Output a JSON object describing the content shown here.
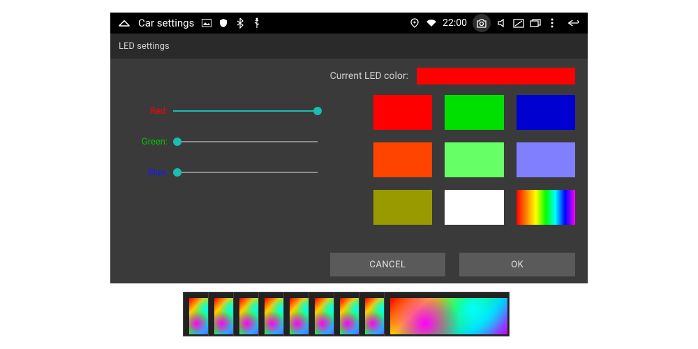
{
  "status": {
    "title": "Car settings",
    "clock": "22:00"
  },
  "page": {
    "header": "LED settings",
    "current_label": "Current LED color:",
    "current_color": "#ff0000"
  },
  "sliders": {
    "red": {
      "label": "Red:",
      "value": 100
    },
    "green": {
      "label": "Green:",
      "value": 3
    },
    "blue": {
      "label": "Blue:",
      "value": 3
    }
  },
  "swatches": [
    {
      "name": "red",
      "color": "#ff0000"
    },
    {
      "name": "green",
      "color": "#00e000"
    },
    {
      "name": "blue",
      "color": "#0000d0"
    },
    {
      "name": "orange",
      "color": "#ff4400"
    },
    {
      "name": "lightgreen",
      "color": "#66ff66"
    },
    {
      "name": "violet",
      "color": "#8080ff"
    },
    {
      "name": "olive",
      "color": "#999900"
    },
    {
      "name": "white",
      "color": "#ffffff"
    },
    {
      "name": "rainbow",
      "color": "rainbow"
    }
  ],
  "buttons": {
    "cancel": "CANCEL",
    "ok": "OK"
  }
}
